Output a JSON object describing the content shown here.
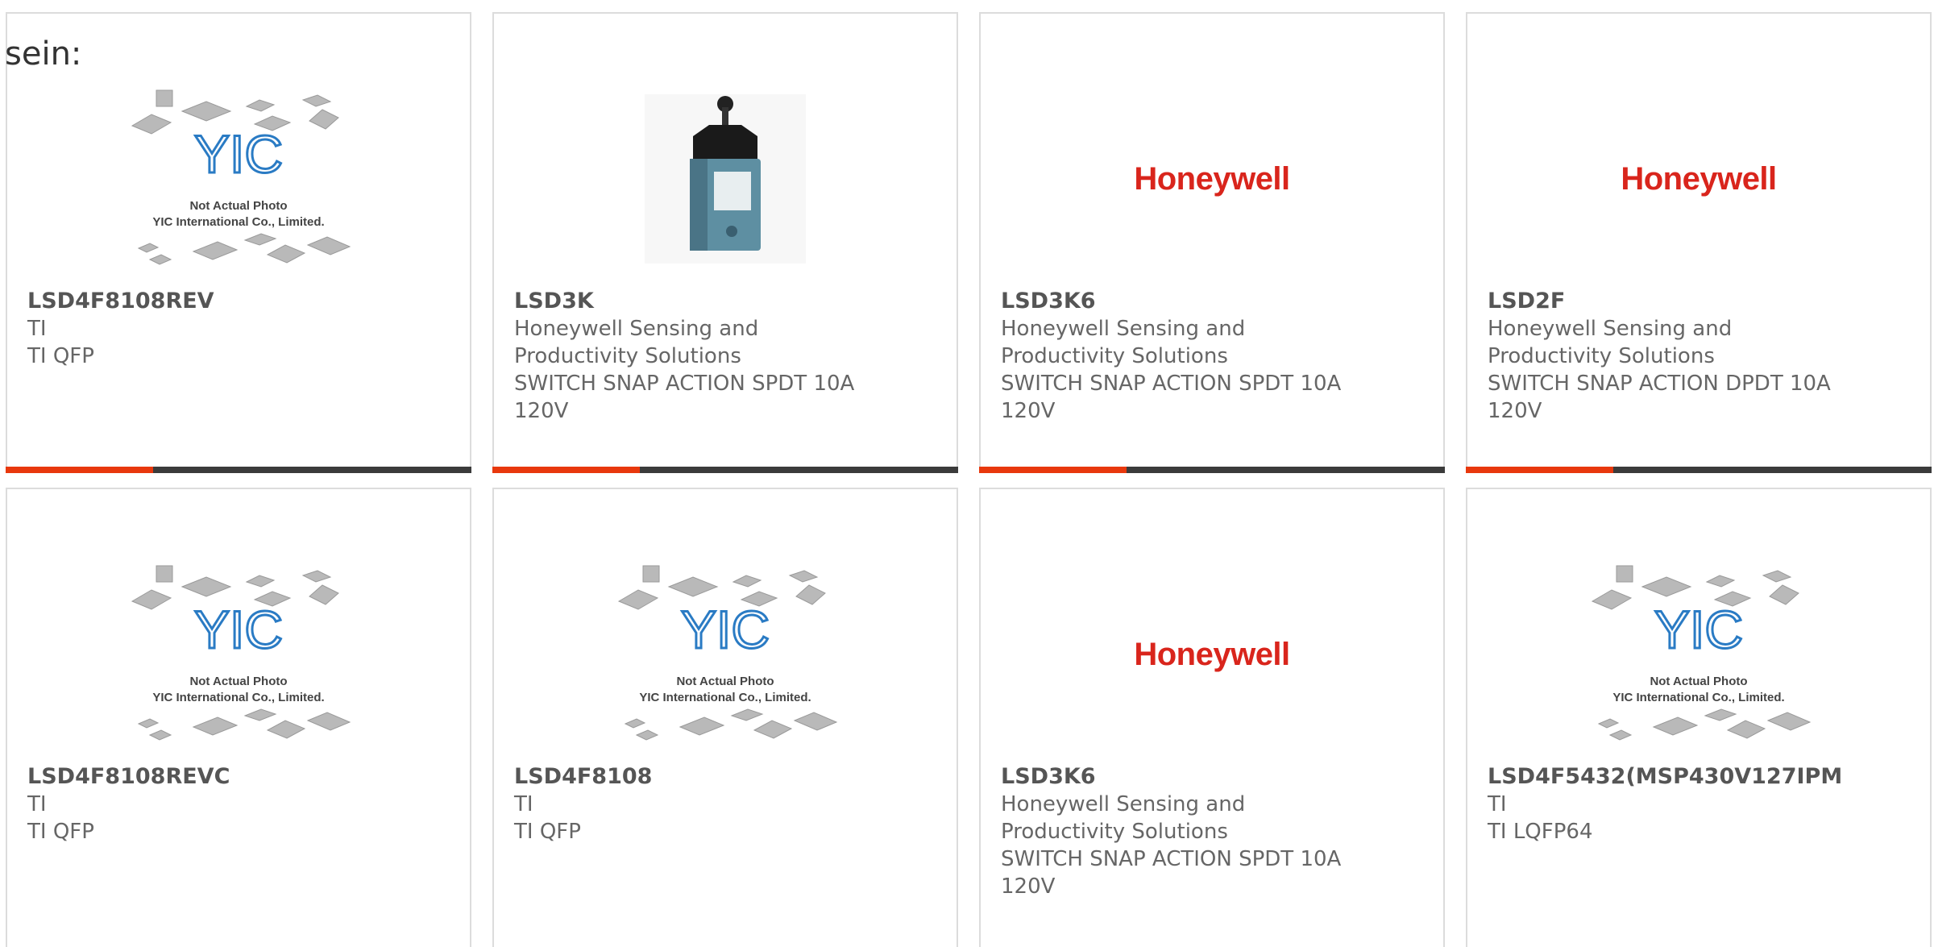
{
  "leading_text": "sein:",
  "placeholder": {
    "logo_text": "YIC",
    "line1": "Not Actual Photo",
    "line2": "YIC International Co., Limited."
  },
  "brand_logo": "Honeywell",
  "colors": {
    "accent": "#e8380d",
    "bar": "#3b3b3b",
    "brand_red": "#d9251c"
  },
  "products": [
    {
      "part": "LSD4F8108REV",
      "image": "placeholder",
      "lines": [
        "TI",
        "TI QFP"
      ]
    },
    {
      "part": "LSD3K",
      "image": "switch-photo",
      "lines": [
        "Honeywell Sensing and",
        "Productivity Solutions",
        "SWITCH SNAP ACTION SPDT 10A",
        "120V"
      ]
    },
    {
      "part": "LSD3K6",
      "image": "brand-logo",
      "lines": [
        "Honeywell Sensing and",
        "Productivity Solutions",
        "SWITCH SNAP ACTION SPDT 10A",
        "120V"
      ]
    },
    {
      "part": "LSD2F",
      "image": "brand-logo",
      "lines": [
        "Honeywell Sensing and",
        "Productivity Solutions",
        "SWITCH SNAP ACTION DPDT 10A",
        "120V"
      ]
    },
    {
      "part": "LSD4F8108REVC",
      "image": "placeholder",
      "lines": [
        "TI",
        "TI QFP"
      ]
    },
    {
      "part": "LSD4F8108",
      "image": "placeholder",
      "lines": [
        "TI",
        "TI QFP"
      ]
    },
    {
      "part": "LSD3K6",
      "image": "brand-logo",
      "lines": [
        "Honeywell Sensing and",
        "Productivity Solutions",
        "SWITCH SNAP ACTION SPDT 10A",
        "120V"
      ]
    },
    {
      "part": "LSD4F5432(MSP430V127IPM",
      "image": "placeholder",
      "lines": [
        "TI",
        "TI LQFP64"
      ]
    }
  ]
}
